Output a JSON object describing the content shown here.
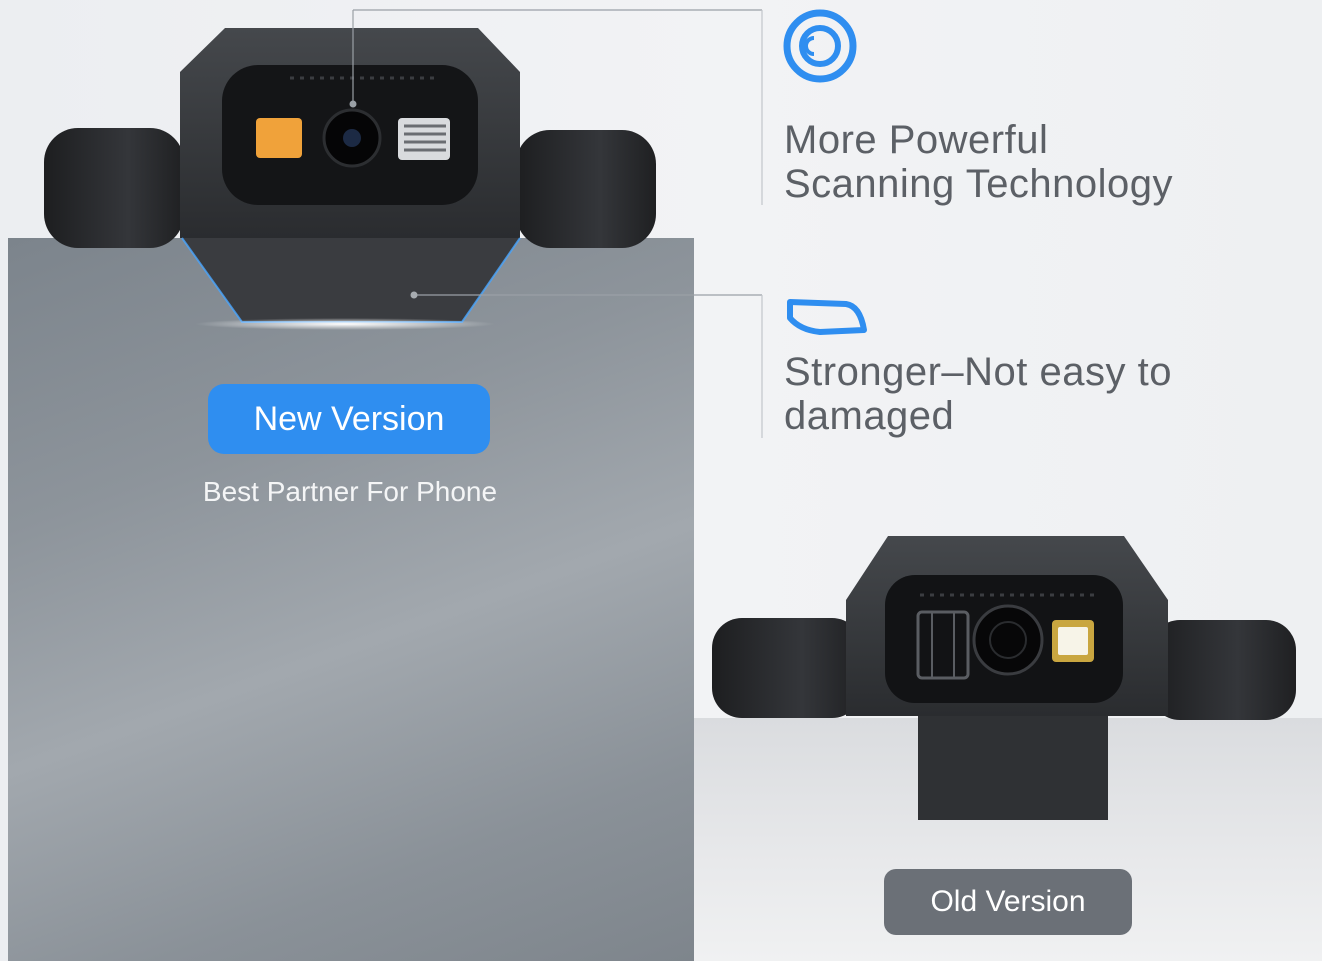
{
  "features": [
    {
      "icon": "target-ring-icon",
      "lines": [
        "More Powerful",
        "Scanning Technology"
      ]
    },
    {
      "icon": "shell-outline-icon",
      "lines": [
        "Stronger–Not easy to",
        "damaged"
      ]
    }
  ],
  "new_version": {
    "badge": "New Version",
    "subtitle": "Best Partner For Phone"
  },
  "old_version": {
    "badge": "Old Version"
  },
  "colors": {
    "accent_blue": "#2f8ef0",
    "text_gray": "#5c6066",
    "old_badge_gray": "#6b7077",
    "device_dark": "#2e3033"
  }
}
